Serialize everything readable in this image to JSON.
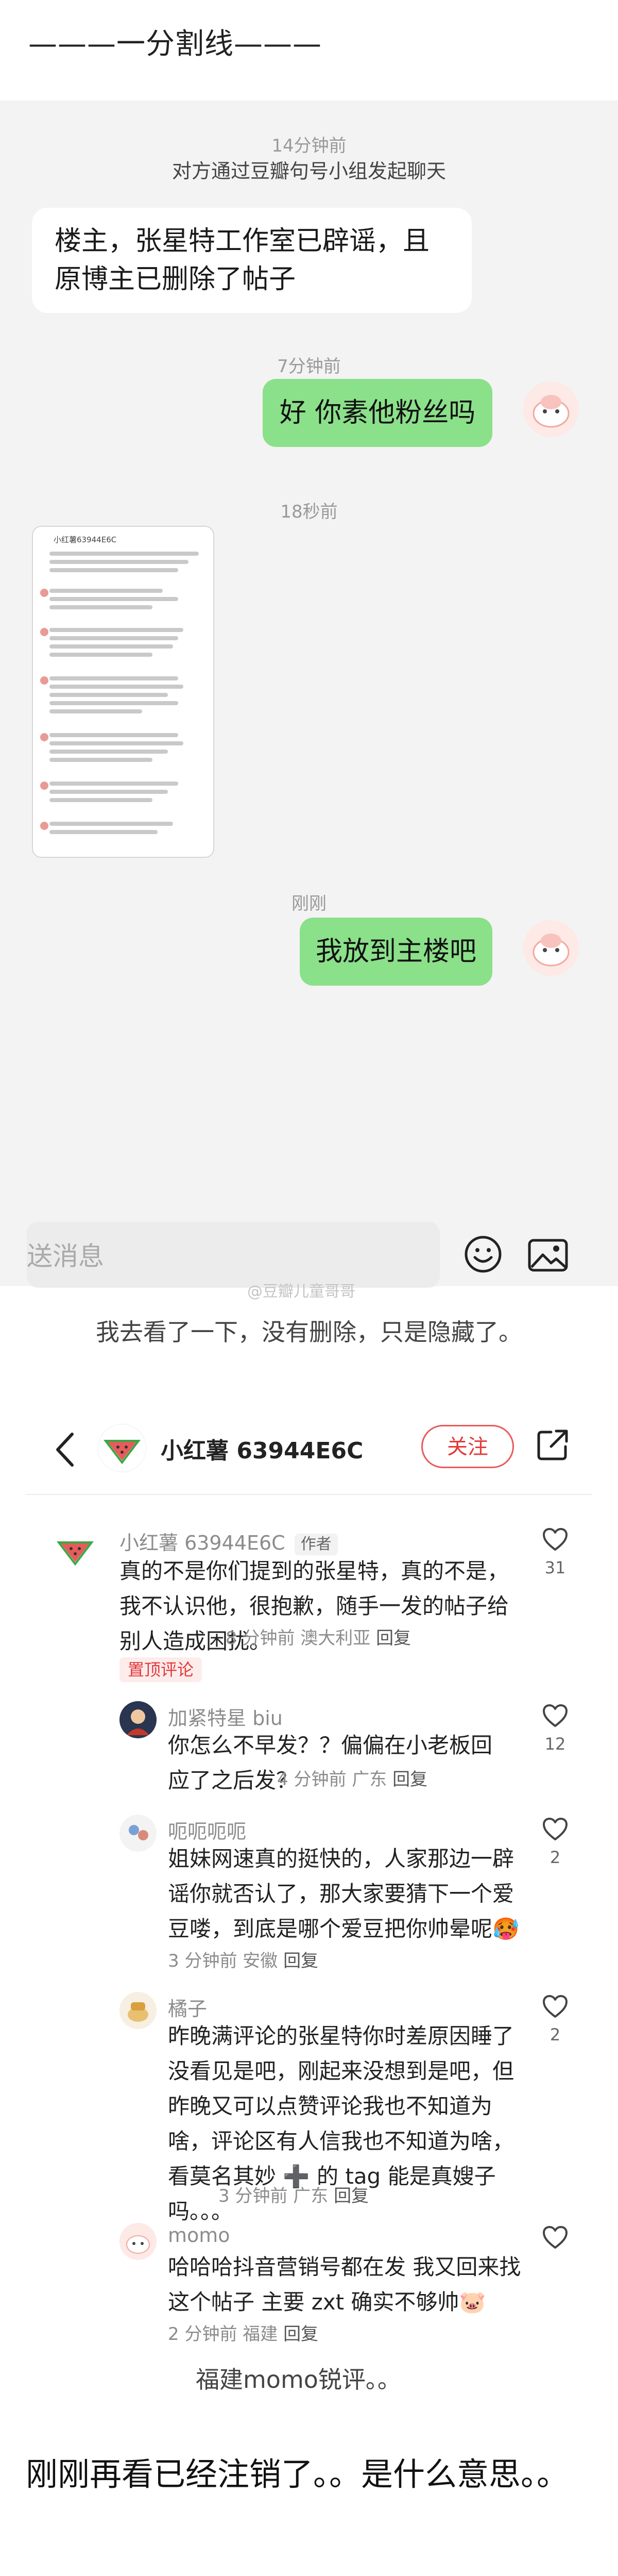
{
  "divider": "———一分割线———",
  "chat": {
    "time1": "14分钟前",
    "system_msg": "对方通过豆瓣句号小组发起聊天",
    "msg1": "楼主，张星特工作室已辟谣，且原博主已删除了帖子",
    "time2": "7分钟前",
    "msg2": "好 你素他粉丝吗",
    "time3": "18秒前",
    "thumb_title": "小红薯63944E6C",
    "time4": "刚刚",
    "msg3": "我放到主楼吧",
    "input_placeholder": "送消息"
  },
  "watermark": "@豆瓣儿童哥哥",
  "note1": "我去看了一下，没有删除，只是隐藏了。",
  "xhs": {
    "header_name": "小红薯 63944E6C",
    "follow_label": "关注",
    "pinned_label": "置顶评论",
    "comments": [
      {
        "user": "小红薯 63944E6C",
        "tag": "作者",
        "text": "真的不是你们提到的张星特，真的不是，我不认识他，很抱歉，随手一发的帖子给别人造成困扰。",
        "meta": "8 分钟前 澳大利亚",
        "reply": "回复",
        "likes": "31"
      },
      {
        "user": "加紧特星 biu",
        "text": "你怎么不早发？？偏偏在小老板回应了之后发？",
        "meta": "4 分钟前 广东",
        "reply": "回复",
        "likes": "12"
      },
      {
        "user": "呃呃呃呃",
        "text": "姐妹网速真的挺快的，人家那边一辟谣你就否认了，那大家要猜下一个爱豆喽，到底是哪个爱豆把你帅晕呢🥵",
        "meta": "3 分钟前 安徽",
        "reply": "回复",
        "likes": "2"
      },
      {
        "user": "橘子",
        "text": "昨晚满评论的张星特你时差原因睡了没看见是吧，刚起来没想到是吧，但昨晚又可以点赞评论我也不知道为啥，评论区有人信我也不知道为啥，看莫名其妙 ➕ 的 tag 能是真嫂子吗。。。",
        "meta": "3 分钟前 广东",
        "reply": "回复",
        "likes": "2"
      },
      {
        "user": "momo",
        "text": "哈哈哈抖音营销号都在发 我又回来找这个帖子 主要 zxt 确实不够帅🐷",
        "meta": "2 分钟前 福建",
        "reply": "回复",
        "likes": ""
      }
    ]
  },
  "note2": "福建momo锐评。。",
  "final_text": "刚刚再看已经注销了。。是什么意思。。",
  "icons": [
    "chevron-left-icon",
    "watermelon-avatar-icon",
    "share-icon",
    "heart-icon",
    "emoji-icon",
    "image-icon"
  ],
  "colors": {
    "bubble_green": "#8be08a",
    "xhs_red": "#e23a3a",
    "chat_bg": "#f3f3f3"
  }
}
